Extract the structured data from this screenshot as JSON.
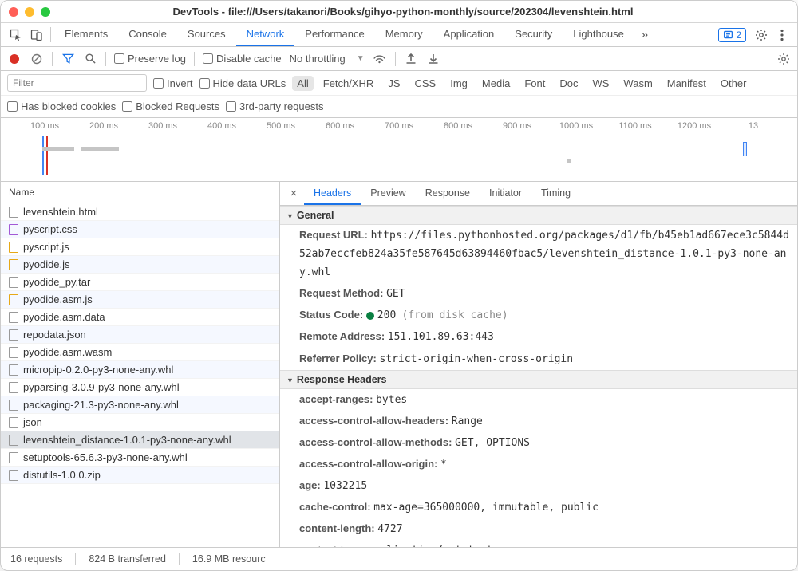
{
  "window": {
    "title": "DevTools - file:///Users/takanori/Books/gihyo-python-monthly/source/202304/levenshtein.html"
  },
  "main_tabs": {
    "items": [
      "Elements",
      "Console",
      "Sources",
      "Network",
      "Performance",
      "Memory",
      "Application",
      "Security",
      "Lighthouse"
    ],
    "active": "Network",
    "overflow_glyph": "»",
    "issues_count": "2"
  },
  "toolbar": {
    "preserve": "Preserve log",
    "disable_cache": "Disable cache",
    "throttle": "No throttling"
  },
  "filters": {
    "placeholder": "Filter",
    "invert": "Invert",
    "hide_data": "Hide data URLs",
    "types": [
      "All",
      "Fetch/XHR",
      "JS",
      "CSS",
      "Img",
      "Media",
      "Font",
      "Doc",
      "WS",
      "Wasm",
      "Manifest",
      "Other"
    ],
    "type_active": "All",
    "row2": [
      "Has blocked cookies",
      "Blocked Requests",
      "3rd-party requests"
    ]
  },
  "timeline": {
    "ticks": [
      "100 ms",
      "200 ms",
      "300 ms",
      "400 ms",
      "500 ms",
      "600 ms",
      "700 ms",
      "800 ms",
      "900 ms",
      "1000 ms",
      "1100 ms",
      "1200 ms",
      "13"
    ]
  },
  "name_header": "Name",
  "requests": [
    {
      "name": "levenshtein.html",
      "kind": "doc"
    },
    {
      "name": "pyscript.css",
      "kind": "css"
    },
    {
      "name": "pyscript.js",
      "kind": "js"
    },
    {
      "name": "pyodide.js",
      "kind": "js"
    },
    {
      "name": "pyodide_py.tar",
      "kind": "doc"
    },
    {
      "name": "pyodide.asm.js",
      "kind": "js"
    },
    {
      "name": "pyodide.asm.data",
      "kind": "doc"
    },
    {
      "name": "repodata.json",
      "kind": "doc"
    },
    {
      "name": "pyodide.asm.wasm",
      "kind": "doc"
    },
    {
      "name": "micropip-0.2.0-py3-none-any.whl",
      "kind": "doc"
    },
    {
      "name": "pyparsing-3.0.9-py3-none-any.whl",
      "kind": "doc"
    },
    {
      "name": "packaging-21.3-py3-none-any.whl",
      "kind": "doc"
    },
    {
      "name": "json",
      "kind": "doc"
    },
    {
      "name": "levenshtein_distance-1.0.1-py3-none-any.whl",
      "kind": "doc",
      "selected": true
    },
    {
      "name": "setuptools-65.6.3-py3-none-any.whl",
      "kind": "doc"
    },
    {
      "name": "distutils-1.0.0.zip",
      "kind": "doc"
    }
  ],
  "details_tabs": {
    "items": [
      "Headers",
      "Preview",
      "Response",
      "Initiator",
      "Timing"
    ],
    "active": "Headers"
  },
  "general": {
    "title": "General",
    "request_url_k": "Request URL:",
    "request_url_v": "https://files.pythonhosted.org/packages/d1/fb/b45eb1ad667ece3c5844d52ab7eccfeb824a35fe587645d63894460fbac5/levenshtein_distance-1.0.1-py3-none-any.whl",
    "method_k": "Request Method:",
    "method_v": "GET",
    "status_k": "Status Code:",
    "status_v": "200",
    "status_extra": "(from disk cache)",
    "remote_k": "Remote Address:",
    "remote_v": "151.101.89.63:443",
    "ref_k": "Referrer Policy:",
    "ref_v": "strict-origin-when-cross-origin"
  },
  "resp": {
    "title": "Response Headers",
    "rows": [
      {
        "k": "accept-ranges:",
        "v": "bytes"
      },
      {
        "k": "access-control-allow-headers:",
        "v": "Range"
      },
      {
        "k": "access-control-allow-methods:",
        "v": "GET, OPTIONS"
      },
      {
        "k": "access-control-allow-origin:",
        "v": "*"
      },
      {
        "k": "age:",
        "v": "1032215"
      },
      {
        "k": "cache-control:",
        "v": "max-age=365000000, immutable, public"
      },
      {
        "k": "content-length:",
        "v": "4727"
      },
      {
        "k": "content-type:",
        "v": "application/octet-stream"
      }
    ]
  },
  "statusbar": {
    "requests": "16 requests",
    "transferred": "824 B transferred",
    "resources": "16.9 MB resourc"
  }
}
